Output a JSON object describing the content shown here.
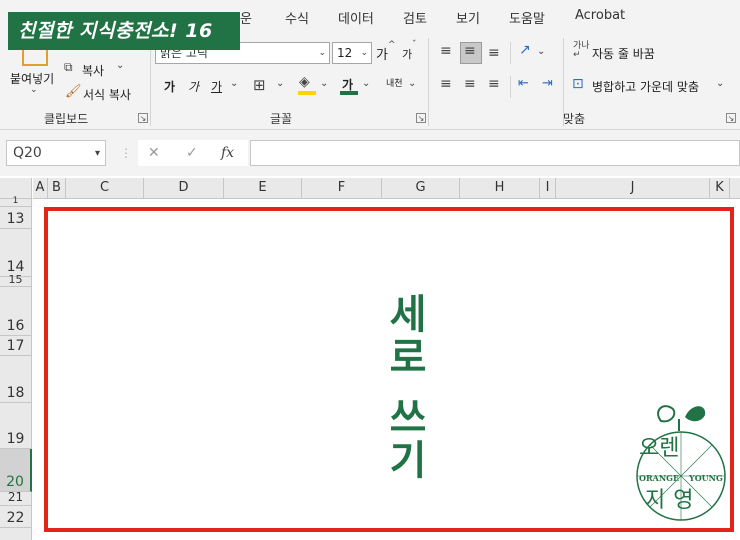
{
  "banner": {
    "title": "친절한 지식충전소! 16"
  },
  "tabs": [
    "운",
    "수식",
    "데이터",
    "검토",
    "보기",
    "도움말",
    "Acrobat"
  ],
  "clipboard": {
    "paste_label": "붙여넣기",
    "copy_label": "복사",
    "format_copy_label": "서식 복사",
    "group_label": "클립보드"
  },
  "font": {
    "name": "맑은 고딕",
    "size": "12",
    "grow_label": "가",
    "shrink_label": "가",
    "bold_label": "가",
    "italic_label": "가",
    "underline_label": "가",
    "color_label": "가",
    "phonetic_label": "내천",
    "group_label": "글꼴",
    "fill_color": "#ffd400",
    "text_color": "#217346"
  },
  "alignment": {
    "wrap_label": "자동 줄 바꿈",
    "merge_label": "병합하고 가운데 맞춤",
    "group_label": "맞춤"
  },
  "formula_bar": {
    "cell_ref": "Q20",
    "cancel_icon": "✕",
    "enter_icon": "✓",
    "fx_label": "fx",
    "value": ""
  },
  "columns": [
    "A",
    "B",
    "C",
    "D",
    "E",
    "F",
    "G",
    "H",
    "I",
    "J",
    "K"
  ],
  "rows": [
    "1",
    "13",
    "14",
    "15",
    "16",
    "17",
    "18",
    "19",
    "20",
    "21",
    "22"
  ],
  "selected_row": "20",
  "content": {
    "vertical_text": "세로 쓰기",
    "logo_top": "오렌",
    "logo_en_left": "ORANGE",
    "logo_en_right": "YOUNG",
    "logo_bottom": "지영",
    "accent_color": "#217346",
    "frame_color": "#e3241b"
  }
}
